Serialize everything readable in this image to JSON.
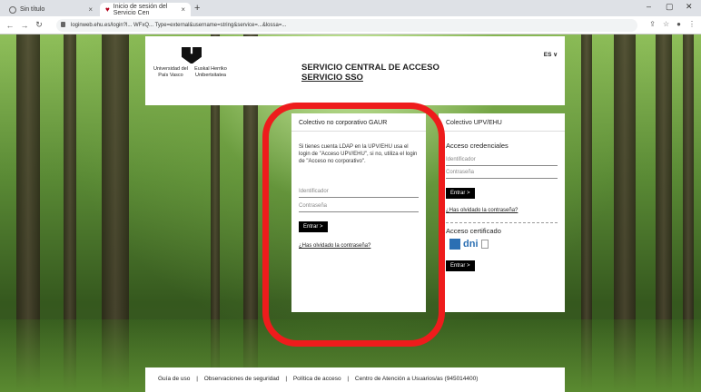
{
  "browser": {
    "tabs": [
      {
        "label": "Sin título"
      },
      {
        "label": "Inicio de sesión del Servicio Cen"
      }
    ],
    "url": "loginweb.ehu.es/login?l...  WFxQ...  Type=external&username=string&service=...&lossa=...",
    "new_tab": "+"
  },
  "header": {
    "logo_left": "Universidad del País Vasco",
    "logo_right": "Euskal Herriko Unibertsitatea",
    "title_line1": "SERVICIO CENTRAL DE ACCESO",
    "title_line2": "SERVICIO SSO",
    "lang": "ES ∨"
  },
  "gaur_card": {
    "heading": "Colectivo no corporativo GAUR",
    "intro": "Si tienes cuenta LDAP en la UPV/EHU usa el login de \"Acceso UPV/EHU\", si no, utiliza el login de \"Acceso no corporativo\".",
    "user_placeholder": "Identificador",
    "pass_placeholder": "Contraseña",
    "button": "Entrar >",
    "forgot": "¿Has olvidado la contraseña?"
  },
  "upv_card": {
    "heading": "Colectivo UPV/EHU",
    "sub": "Acceso credenciales",
    "user_placeholder": "Identificador",
    "pass_placeholder": "Contraseña",
    "button": "Entrar >",
    "forgot": "¿Has olvidado la contraseña?",
    "cert_title": "Acceso certificado",
    "dni": "dni",
    "cert_button": "Entrar >"
  },
  "footer": {
    "links": [
      "Guía de uso",
      "Observaciones de seguridad",
      "Política de acceso",
      "Centro de Atención a Usuarios/as (945014400)"
    ],
    "sep": "|"
  },
  "colors": {
    "highlight": "#ee1c1c",
    "dni": "#2b6fb3"
  }
}
